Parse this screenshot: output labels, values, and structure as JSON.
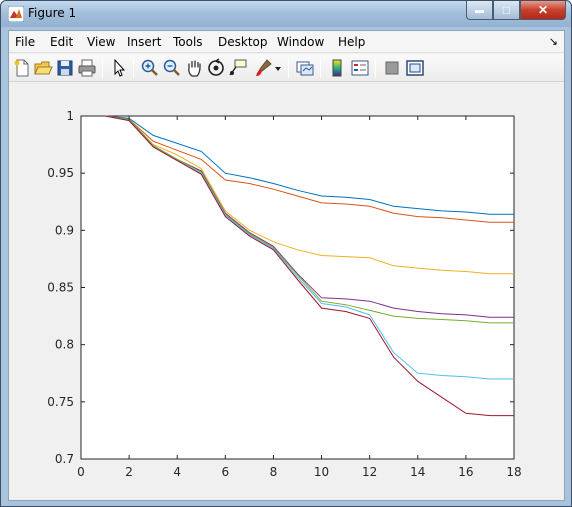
{
  "window": {
    "title": "Figure 1",
    "minimize_glyph": "▬",
    "maximize_glyph": "□",
    "close_glyph": "✕"
  },
  "menu": {
    "items": [
      "File",
      "Edit",
      "View",
      "Insert",
      "Tools",
      "Desktop",
      "Window",
      "Help"
    ],
    "dock_arrow": "↘"
  },
  "toolbar": {
    "buttons": [
      "new-figure",
      "open-file",
      "save",
      "print",
      "edit-plot-pointer",
      "zoom-in",
      "zoom-out",
      "pan",
      "rotate-3d",
      "data-cursor",
      "brush",
      "brush-dropdown",
      "link-plot",
      "insert-colorbar",
      "insert-legend",
      "hide-plot-tools",
      "show-plot-tools"
    ]
  },
  "colors": {
    "series": [
      "#0072BD",
      "#D95319",
      "#EDB120",
      "#7E2F8E",
      "#77AC30",
      "#4DBEEE",
      "#A2142F"
    ]
  },
  "chart_data": {
    "type": "line",
    "title": "",
    "xlabel": "",
    "ylabel": "",
    "xlim": [
      0,
      18
    ],
    "ylim": [
      0.7,
      1
    ],
    "xticks": [
      0,
      2,
      4,
      6,
      8,
      10,
      12,
      14,
      16,
      18
    ],
    "yticks": [
      0.7,
      0.75,
      0.8,
      0.85,
      0.9,
      0.95,
      1
    ],
    "ytick_labels": [
      "0.7",
      "0.75",
      "0.8",
      "0.85",
      "0.9",
      "0.95",
      "1"
    ],
    "xtick_labels": [
      "0",
      "2",
      "4",
      "6",
      "8",
      "10",
      "12",
      "14",
      "16",
      "18"
    ],
    "grid": false,
    "legend": "none",
    "x": [
      1,
      2,
      3,
      4,
      5,
      6,
      7,
      8,
      9,
      10,
      11,
      12,
      13,
      14,
      15,
      16,
      17,
      18
    ],
    "series": [
      {
        "values": [
          1.0,
          0.998,
          0.983,
          0.976,
          0.969,
          0.95,
          0.946,
          0.941,
          0.935,
          0.93,
          0.929,
          0.927,
          0.921,
          0.919,
          0.917,
          0.916,
          0.914,
          0.914
        ]
      },
      {
        "values": [
          1.0,
          0.997,
          0.978,
          0.97,
          0.962,
          0.944,
          0.941,
          0.936,
          0.93,
          0.924,
          0.923,
          0.921,
          0.915,
          0.912,
          0.911,
          0.909,
          0.907,
          0.907
        ]
      },
      {
        "values": [
          1.0,
          0.997,
          0.975,
          0.966,
          0.954,
          0.917,
          0.9,
          0.89,
          0.883,
          0.878,
          0.877,
          0.876,
          0.869,
          0.867,
          0.865,
          0.864,
          0.862,
          0.862
        ]
      },
      {
        "values": [
          1.0,
          0.997,
          0.974,
          0.962,
          0.952,
          0.915,
          0.898,
          0.886,
          0.862,
          0.841,
          0.84,
          0.838,
          0.832,
          0.829,
          0.827,
          0.826,
          0.824,
          0.824
        ]
      },
      {
        "values": [
          1.0,
          0.997,
          0.974,
          0.962,
          0.951,
          0.914,
          0.897,
          0.885,
          0.861,
          0.838,
          0.835,
          0.83,
          0.825,
          0.823,
          0.822,
          0.821,
          0.819,
          0.819
        ]
      },
      {
        "values": [
          1.0,
          0.996,
          0.973,
          0.961,
          0.95,
          0.913,
          0.896,
          0.884,
          0.859,
          0.836,
          0.833,
          0.826,
          0.793,
          0.775,
          0.773,
          0.772,
          0.77,
          0.77
        ]
      },
      {
        "values": [
          1.0,
          0.996,
          0.973,
          0.961,
          0.949,
          0.912,
          0.895,
          0.883,
          0.857,
          0.832,
          0.829,
          0.823,
          0.789,
          0.768,
          0.754,
          0.74,
          0.738,
          0.738
        ]
      }
    ]
  }
}
